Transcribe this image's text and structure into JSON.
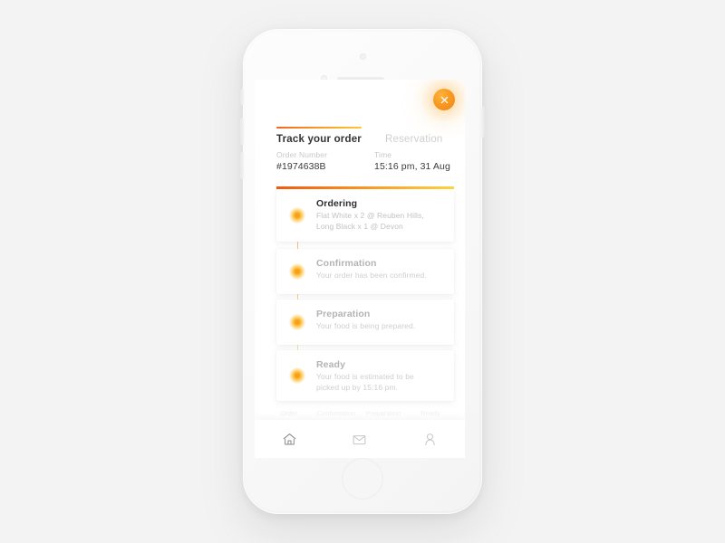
{
  "background_color": "#f3f3f3",
  "accent": {
    "orange": "#f79a22",
    "gradient_start": "#ef5a12",
    "gradient_end": "#fdd33f"
  },
  "device": {
    "name": "white-smartphone",
    "hardware": {
      "camera": "camera-dot",
      "sensor": "sensor-dot",
      "speaker": "speaker-grille",
      "home_button": "home-button",
      "silent_switch": "silent-switch",
      "volume_up": "volume-up-button",
      "volume_down": "volume-down-button",
      "power": "power-button"
    }
  },
  "screen": {
    "close_button": {
      "icon": "close-icon",
      "label": "Close"
    },
    "tabs": [
      {
        "label": "Track your order",
        "active": true
      },
      {
        "label": "Reservation",
        "active": false
      }
    ],
    "meta": {
      "order": {
        "label": "Order Number",
        "value": "#1974638B"
      },
      "time": {
        "label": "Time",
        "value": "15:16 pm, 31 Aug"
      }
    },
    "steps": [
      {
        "title": "Ordering",
        "description": "Flat White x 2 @ Reuben Hills,\nLong Black x 1 @ Devon",
        "state": "active"
      },
      {
        "title": "Confirmation",
        "description": "Your order has been confirmed.",
        "state": "pending"
      },
      {
        "title": "Preparation",
        "description": "Your food is being prepared.",
        "state": "pending"
      },
      {
        "title": "Ready",
        "description": "Your food is estimated to be\npicked up by 15:16 pm.",
        "state": "pending"
      }
    ],
    "progress_strip": [
      "Order",
      "Confirmation",
      "Preparation",
      "Ready"
    ],
    "bottom_nav": [
      {
        "icon": "home-icon",
        "label": "Home",
        "active": true
      },
      {
        "icon": "mail-icon",
        "label": "Messages",
        "active": false
      },
      {
        "icon": "person-icon",
        "label": "Profile",
        "active": false
      }
    ]
  }
}
